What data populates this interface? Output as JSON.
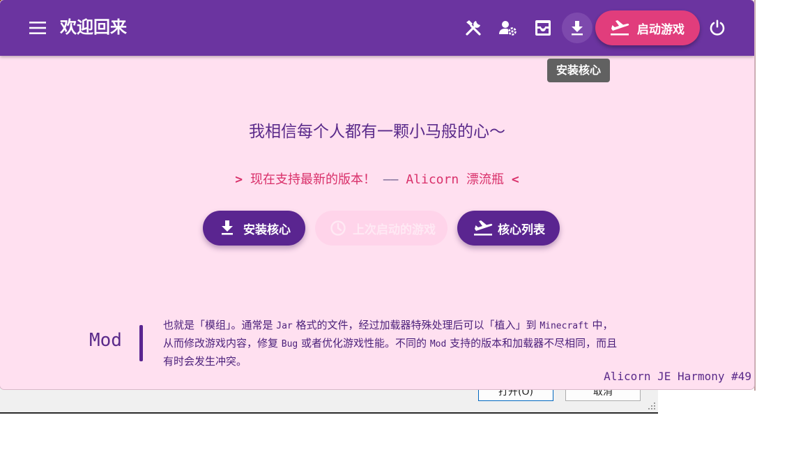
{
  "header": {
    "title": "欢迎回来",
    "tooltip": "安装核心",
    "launch_label": "启动游戏",
    "icons": [
      "menu-icon",
      "tools-icon",
      "user-settings-icon",
      "inbox-icon",
      "download-icon",
      "flight-takeoff-icon",
      "power-icon"
    ]
  },
  "main": {
    "headline": "我相信每个人都有一颗小马般的心～",
    "subline": {
      "open_mark": ">",
      "text": "现在支持最新的版本！",
      "dash": "——",
      "source": "Alicorn 漂流瓶",
      "close_mark": "<"
    },
    "actions": {
      "install_label": "安装核心",
      "last_launched_label": "上次启动的游戏",
      "core_list_label": "核心列表"
    }
  },
  "tip": {
    "term": "Mod",
    "line1_a": "也就是「模组」。通常是 ",
    "line1_jar": "Jar",
    "line1_b": " 格式的文件，经过加载器特殊处理后可以「植入」到 ",
    "line1_mc": "Minecraft",
    "line1_c": " 中，",
    "line2_a": "从而修改游戏内容，修复 ",
    "line2_bug": "Bug",
    "line2_b": " 或者优化游戏性能。不同的 ",
    "line2_mod": "Mod",
    "line2_c": " 支持的版本和加载器不尽相同，而且",
    "line3": "有时会发生冲突。"
  },
  "footer": {
    "version": "Alicorn JE Harmony #49"
  },
  "background_dialog": {
    "open_button": "打开(O)",
    "cancel_button": "取消"
  },
  "colors": {
    "topbar": "#6b34a0",
    "accent": "#e13d7c",
    "background": "#ffe0f0",
    "primary_button": "#5a2590"
  }
}
